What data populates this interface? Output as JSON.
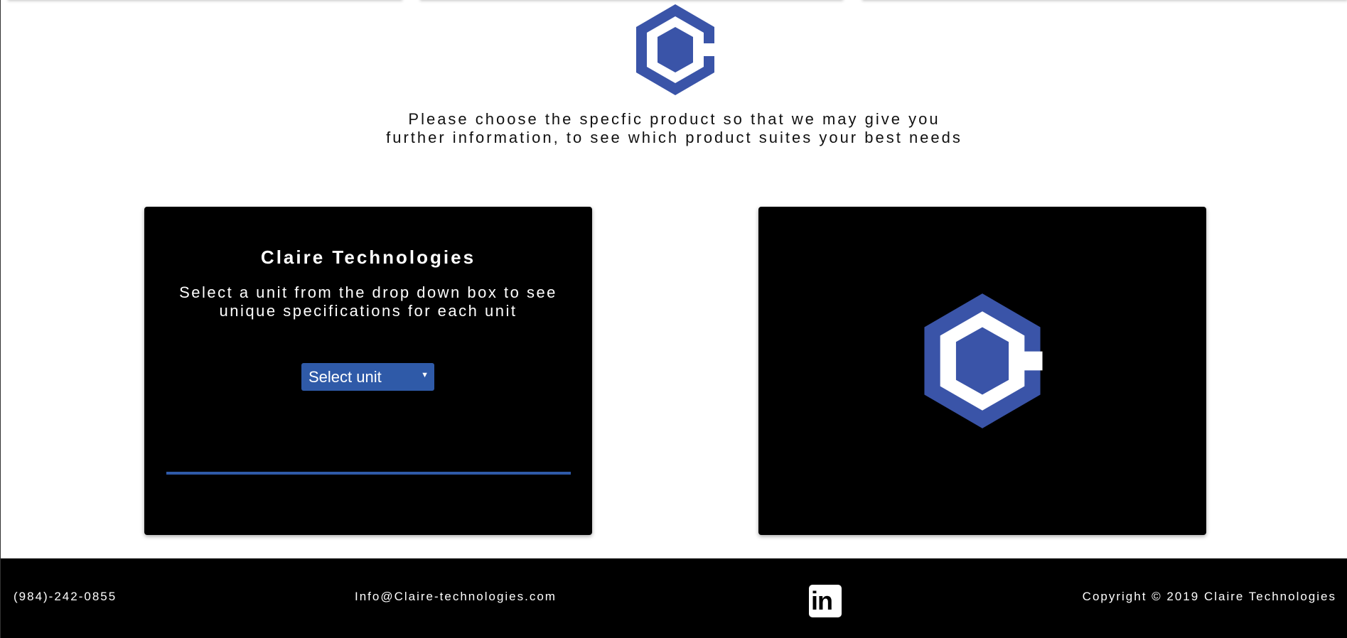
{
  "intro": {
    "text": "Please choose the specfic product so that we may give you further information, to see which product suites your best needs"
  },
  "product_panel": {
    "title": "Claire Technologies",
    "description": "Select a unit from the drop down box to see unique specifications for each unit",
    "select_value": "Select unit"
  },
  "footer": {
    "phone": "(984)-242-0855",
    "email": "Info@Claire-technologies.com",
    "linkedin_label": "in",
    "copyright": "Copyright © 2019 Claire Technologies"
  },
  "colors": {
    "brand_blue": "#3a54a8",
    "accent_blue": "#2f5aa8",
    "panel_bg": "#000000"
  },
  "icons": {
    "brand_logo": "hexagon-c-logo-icon",
    "social": "linkedin-icon"
  }
}
